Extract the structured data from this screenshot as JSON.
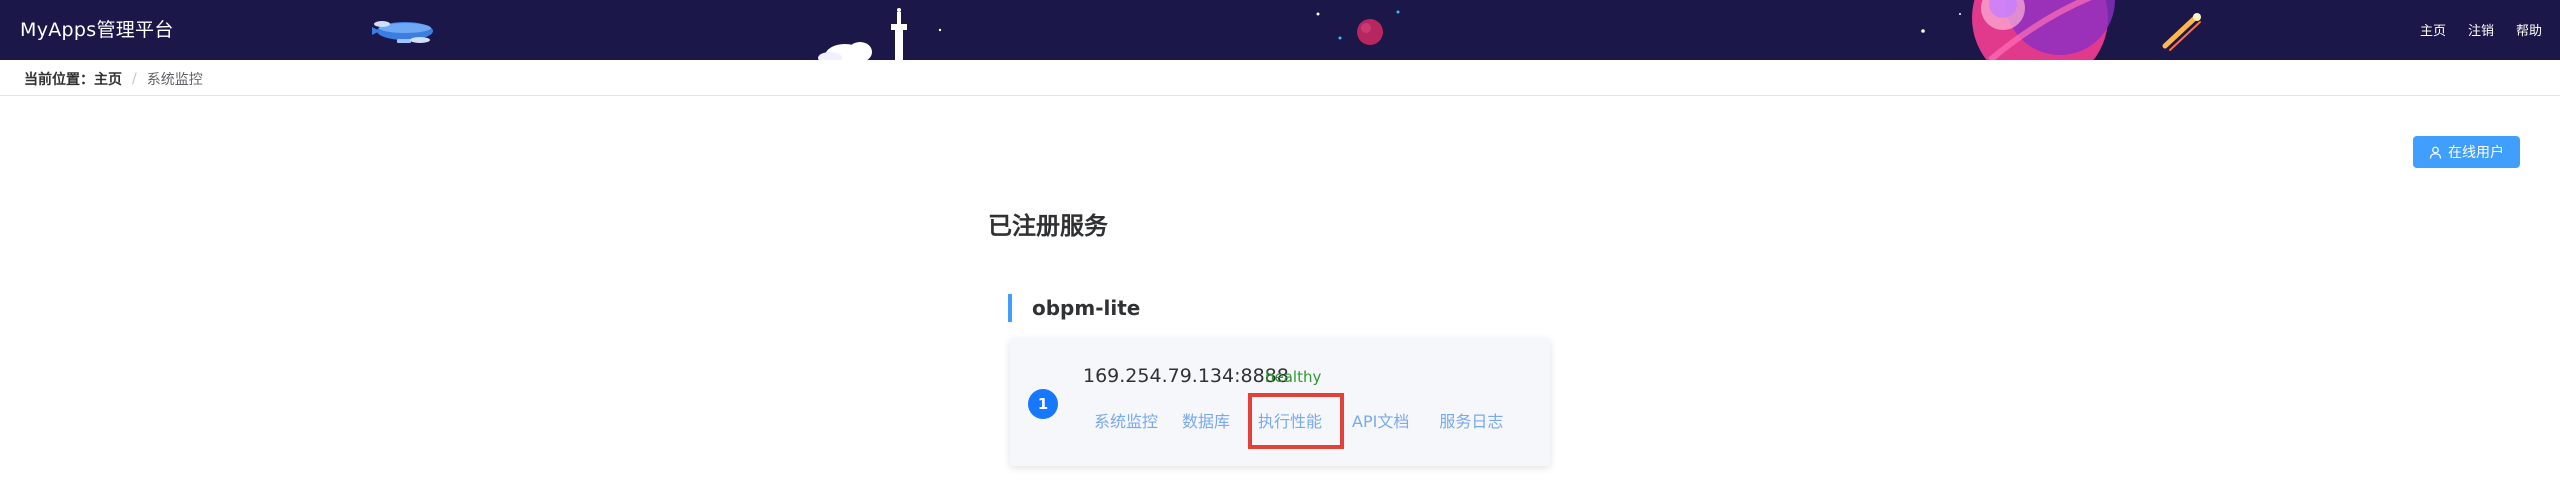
{
  "header": {
    "brand": "MyApps管理平台",
    "nav": [
      "主页",
      "注销",
      "帮助"
    ]
  },
  "breadcrumb": {
    "prefix": "当前位置：",
    "home": "主页",
    "separator": "/",
    "current": "系统监控"
  },
  "online_button": {
    "label": "在线用户",
    "icon": "user-icon",
    "color": "#409eff"
  },
  "main": {
    "title": "已注册服务",
    "services": [
      {
        "name": "obpm-lite",
        "instances": [
          {
            "index": "1",
            "address": "169.254.79.134:8888",
            "status": "healthy",
            "status_color": "#2e9a2e",
            "links": [
              "系统监控",
              "数据库",
              "执行性能",
              "API文档",
              "服务日志"
            ],
            "highlighted_link": "执行性能"
          }
        ]
      }
    ]
  },
  "colors": {
    "header_bg": "#1b1748",
    "accent": "#409eff",
    "index_badge": "#1677ff",
    "highlight_box": "#e5413b",
    "link": "#79a9f2"
  }
}
